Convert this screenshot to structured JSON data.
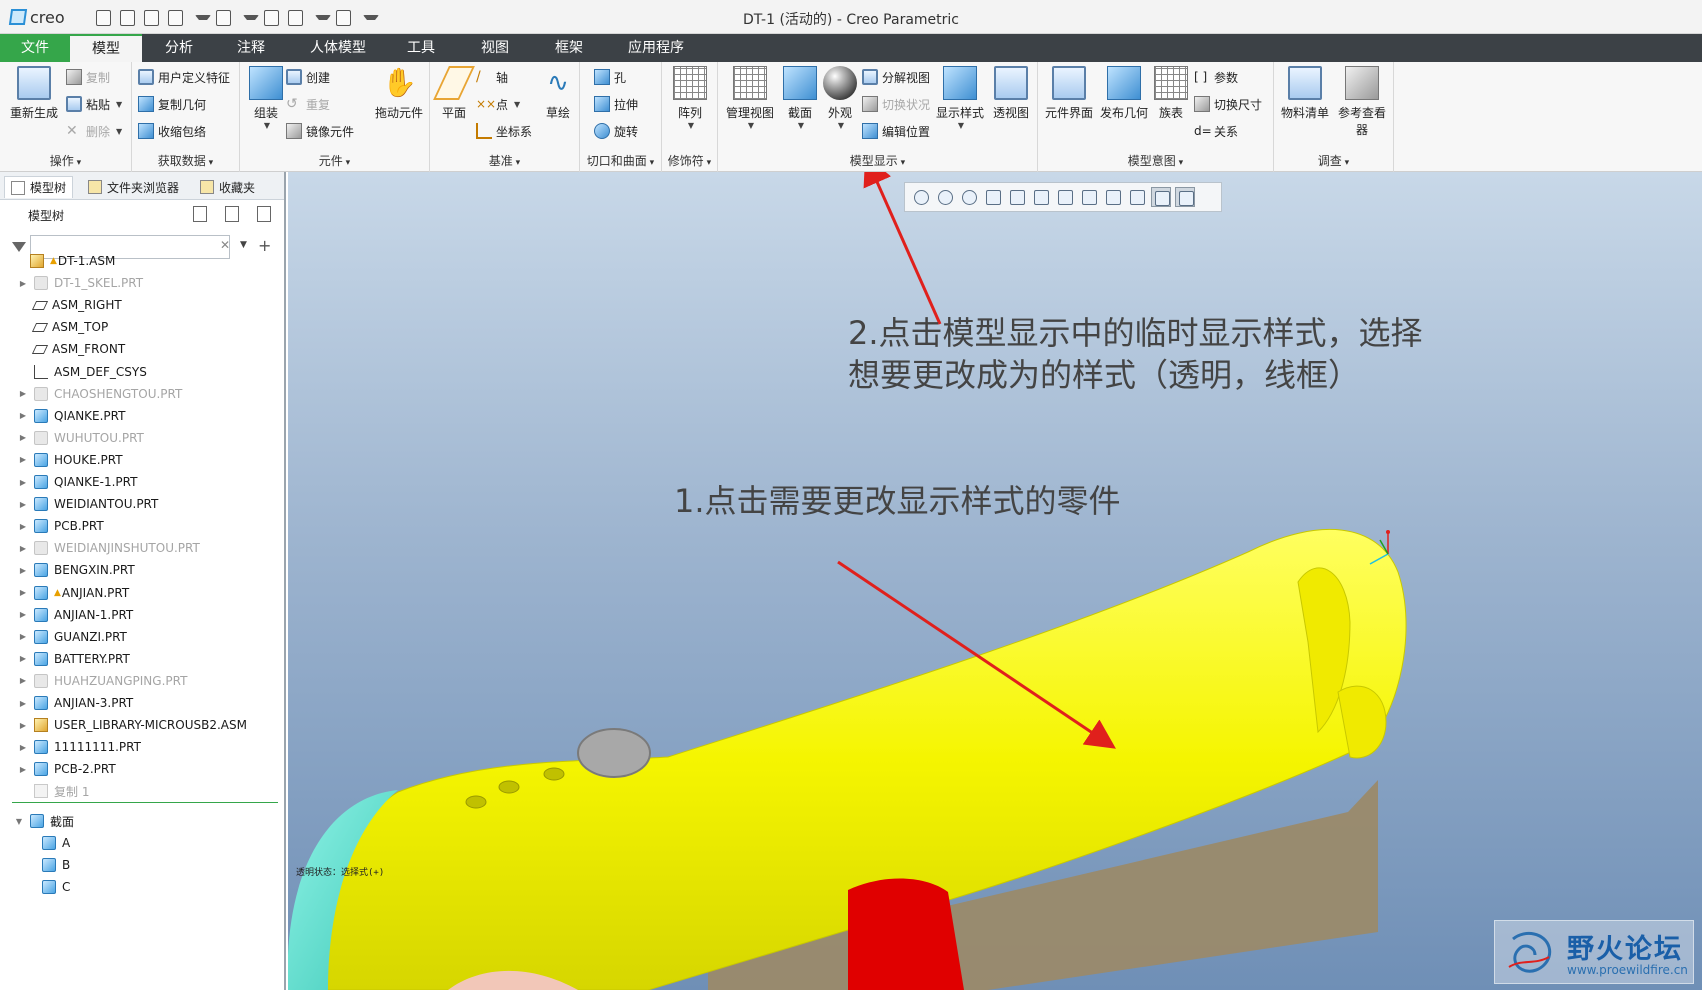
{
  "app": {
    "logo_text": "creo",
    "window_title": "DT-1 (活动的) - Creo Parametric"
  },
  "tabs": [
    {
      "label": "文件"
    },
    {
      "label": "模型"
    },
    {
      "label": "分析"
    },
    {
      "label": "注释"
    },
    {
      "label": "人体模型"
    },
    {
      "label": "工具"
    },
    {
      "label": "视图"
    },
    {
      "label": "框架"
    },
    {
      "label": "应用程序"
    }
  ],
  "ribbon": {
    "groups": {
      "operations": "操作",
      "get_data": "获取数据",
      "component": "元件",
      "datum": "基准",
      "cut_surface": "切口和曲面",
      "modifier": "修饰符",
      "model_display": "模型显示",
      "model_intent": "模型意图",
      "investigate": "调查"
    },
    "buttons": {
      "regenerate": "重新生成",
      "copy": "复制",
      "paste": "粘贴",
      "delete": "删除",
      "user_feature": "用户定义特征",
      "copy_geometry": "复制几何",
      "shrinkwrap": "收缩包络",
      "assemble": "组装",
      "create": "创建",
      "repeat": "重复",
      "mirror_component": "镜像元件",
      "drag_component": "拖动元件",
      "plane": "平面",
      "axis": "轴",
      "point": "点",
      "csys": "坐标系",
      "sketch": "草绘",
      "hole": "孔",
      "extrude": "拉伸",
      "revolve": "旋转",
      "pattern": "阵列",
      "manage_views": "管理视图",
      "section": "截面",
      "appearance": "外观",
      "explode_view": "分解视图",
      "toggle_status": "切换状况",
      "edit_position": "编辑位置",
      "display_style": "显示样式",
      "perspective": "透视图",
      "component_interface": "元件界面",
      "publish_geometry": "发布几何",
      "family_table": "族表",
      "parameters": "参数",
      "switch_dimensions": "切换尺寸",
      "relations": "关系",
      "bom": "物料清单",
      "reference_viewer": "参考查看器"
    }
  },
  "left_pane": {
    "tabs": {
      "model_tree": "模型树",
      "folder_browser": "文件夹浏览器",
      "favorites": "收藏夹"
    },
    "tree_title": "模型树",
    "search_value": "",
    "items": [
      {
        "label": "DT-1.ASM",
        "icon": "assembly-icon",
        "warn": true,
        "dim": false,
        "expandable": false,
        "indent": 0
      },
      {
        "label": "DT-1_SKEL.PRT",
        "icon": "part-icon",
        "warn": false,
        "dim": true,
        "expandable": true,
        "indent": 1
      },
      {
        "label": "ASM_RIGHT",
        "icon": "datum-plane-icon",
        "warn": false,
        "dim": false,
        "expandable": false,
        "indent": 1
      },
      {
        "label": "ASM_TOP",
        "icon": "datum-plane-icon",
        "warn": false,
        "dim": false,
        "expandable": false,
        "indent": 1
      },
      {
        "label": "ASM_FRONT",
        "icon": "datum-plane-icon",
        "warn": false,
        "dim": false,
        "expandable": false,
        "indent": 1
      },
      {
        "label": "ASM_DEF_CSYS",
        "icon": "csys-icon",
        "warn": false,
        "dim": false,
        "expandable": false,
        "indent": 1
      },
      {
        "label": "CHAOSHENGTOU.PRT",
        "icon": "part-icon",
        "warn": false,
        "dim": true,
        "expandable": true,
        "indent": 1
      },
      {
        "label": "QIANKE.PRT",
        "icon": "part-icon",
        "warn": false,
        "dim": false,
        "expandable": true,
        "indent": 1
      },
      {
        "label": "WUHUTOU.PRT",
        "icon": "part-icon",
        "warn": false,
        "dim": true,
        "expandable": true,
        "indent": 1
      },
      {
        "label": "HOUKE.PRT",
        "icon": "part-icon",
        "warn": false,
        "dim": false,
        "expandable": true,
        "indent": 1
      },
      {
        "label": "QIANKE-1.PRT",
        "icon": "part-icon",
        "warn": false,
        "dim": false,
        "expandable": true,
        "indent": 1
      },
      {
        "label": "WEIDIANTOU.PRT",
        "icon": "part-icon",
        "warn": false,
        "dim": false,
        "expandable": true,
        "indent": 1
      },
      {
        "label": "PCB.PRT",
        "icon": "part-icon",
        "warn": false,
        "dim": false,
        "expandable": true,
        "indent": 1
      },
      {
        "label": "WEIDIANJINSHUTOU.PRT",
        "icon": "part-icon",
        "warn": false,
        "dim": true,
        "expandable": true,
        "indent": 1
      },
      {
        "label": "BENGXIN.PRT",
        "icon": "part-icon",
        "warn": false,
        "dim": false,
        "expandable": true,
        "indent": 1
      },
      {
        "label": "ANJIAN.PRT",
        "icon": "part-icon",
        "warn": true,
        "dim": false,
        "expandable": true,
        "indent": 1
      },
      {
        "label": "ANJIAN-1.PRT",
        "icon": "part-icon",
        "warn": false,
        "dim": false,
        "expandable": true,
        "indent": 1
      },
      {
        "label": "GUANZI.PRT",
        "icon": "part-icon",
        "warn": false,
        "dim": false,
        "expandable": true,
        "indent": 1
      },
      {
        "label": "BATTERY.PRT",
        "icon": "part-icon",
        "warn": false,
        "dim": false,
        "expandable": true,
        "indent": 1
      },
      {
        "label": "HUAHZUANGPING.PRT",
        "icon": "part-icon",
        "warn": false,
        "dim": true,
        "expandable": true,
        "indent": 1
      },
      {
        "label": "ANJIAN-3.PRT",
        "icon": "part-icon",
        "warn": false,
        "dim": false,
        "expandable": true,
        "indent": 1
      },
      {
        "label": "USER_LIBRARY-MICROUSB2.ASM",
        "icon": "assembly-icon",
        "warn": false,
        "dim": false,
        "expandable": true,
        "indent": 1
      },
      {
        "label": "11111111.PRT",
        "icon": "part-icon",
        "warn": false,
        "dim": false,
        "expandable": true,
        "indent": 1
      },
      {
        "label": "PCB-2.PRT",
        "icon": "part-icon",
        "warn": false,
        "dim": false,
        "expandable": true,
        "indent": 1
      },
      {
        "label": "复制 1",
        "icon": "copy-icon",
        "warn": false,
        "dim": true,
        "expandable": false,
        "indent": 1
      }
    ],
    "sections": {
      "label": "截面",
      "items": [
        "A",
        "B",
        "C"
      ]
    }
  },
  "viewport": {
    "annotation_1": "1.点击需要更改显示样式的零件",
    "annotation_2_line1": "2.点击模型显示中的临时显示样式，选择",
    "annotation_2_line2": "想要更改成为的样式（透明，线框）",
    "status_label": "透明状态：选择式(+)",
    "colors": {
      "body": "#f5f500",
      "cap": "#6ee8d8",
      "button": "#a8a8a8",
      "block": "#e00000",
      "base": "#9a8a6a",
      "arrow": "#e0201c"
    }
  },
  "watermark": {
    "title": "野火论坛",
    "url": "www.proewildfire.cn"
  }
}
